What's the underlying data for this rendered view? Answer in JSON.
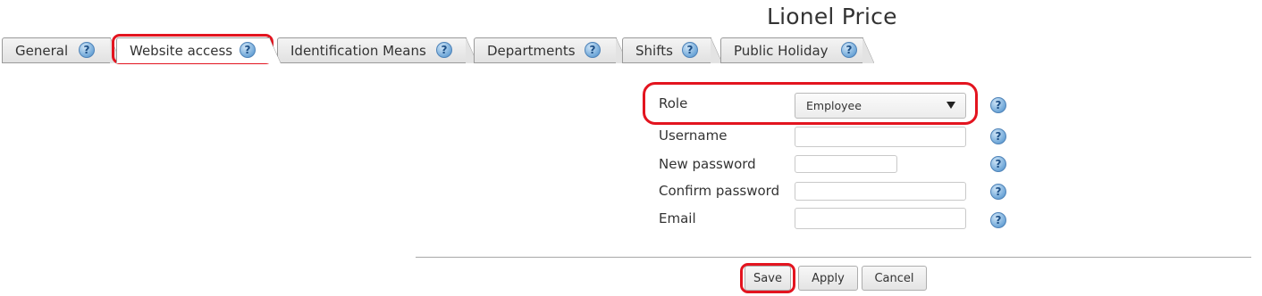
{
  "header": {
    "title": "Lionel Price"
  },
  "tabs": [
    {
      "label": "General",
      "help": "?"
    },
    {
      "label": "Website access",
      "help": "?"
    },
    {
      "label": "Identification Means",
      "help": "?"
    },
    {
      "label": "Departments",
      "help": "?"
    },
    {
      "label": "Shifts",
      "help": "?"
    },
    {
      "label": "Public Holiday",
      "help": "?"
    }
  ],
  "form": {
    "role": {
      "label": "Role",
      "value": "Employee"
    },
    "username": {
      "label": "Username",
      "value": ""
    },
    "new_password": {
      "label": "New password",
      "value": ""
    },
    "confirm_password": {
      "label": "Confirm password",
      "value": ""
    },
    "email": {
      "label": "Email",
      "value": ""
    },
    "help": "?"
  },
  "buttons": {
    "save": "Save",
    "apply": "Apply",
    "cancel": "Cancel"
  },
  "colors": {
    "highlight": "#e3141f",
    "help_icon": "#6fa7d8"
  }
}
